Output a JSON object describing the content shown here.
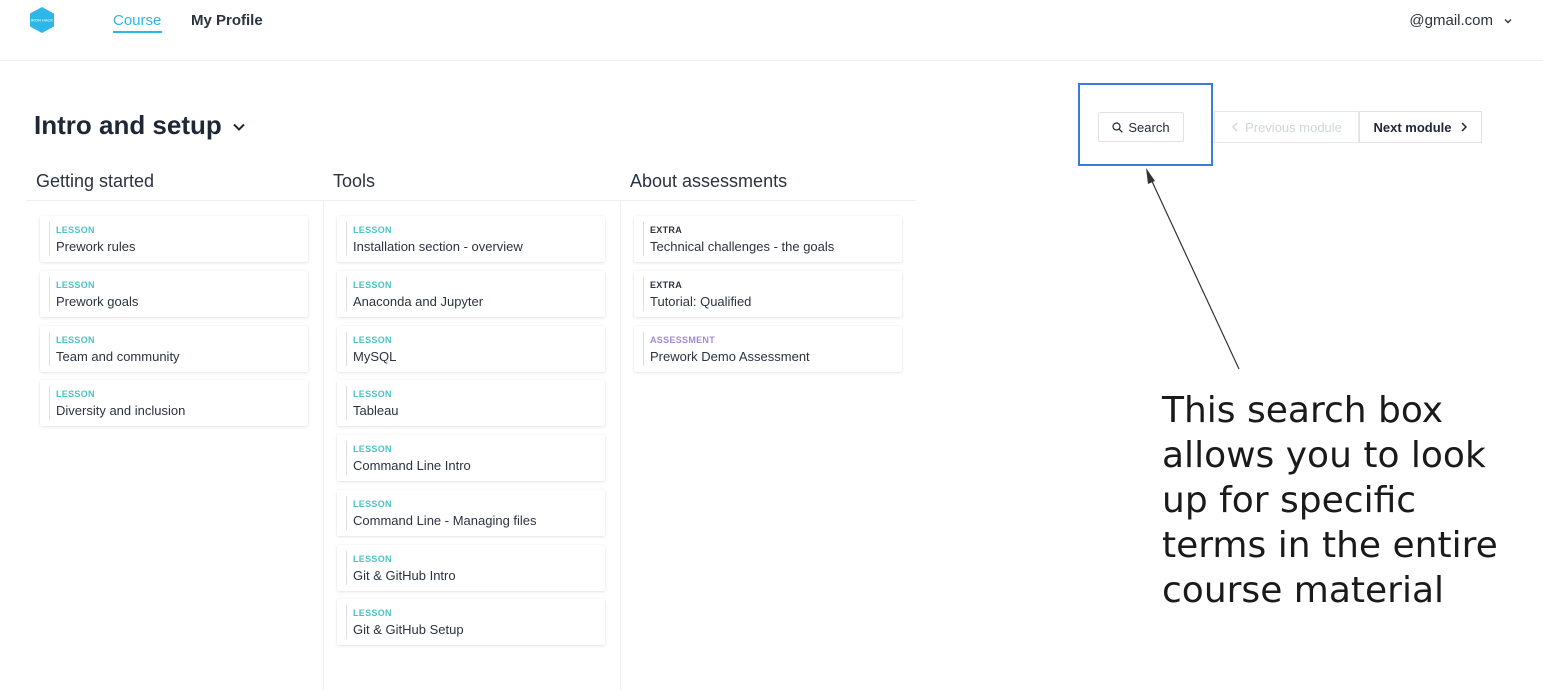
{
  "nav": {
    "course": "Course",
    "profile": "My Profile",
    "account": "@gmail.com",
    "logo_text": "IRON HACK"
  },
  "module": {
    "title": "Intro and setup"
  },
  "toolbar": {
    "search": "Search",
    "previous": "Previous module",
    "next": "Next module"
  },
  "columns": [
    {
      "heading": "Getting started",
      "items": [
        {
          "tag": "LESSON",
          "title": "Prework rules"
        },
        {
          "tag": "LESSON",
          "title": "Prework goals"
        },
        {
          "tag": "LESSON",
          "title": "Team and community"
        },
        {
          "tag": "LESSON",
          "title": "Diversity and inclusion"
        }
      ]
    },
    {
      "heading": "Tools",
      "items": [
        {
          "tag": "LESSON",
          "title": "Installation section - overview"
        },
        {
          "tag": "LESSON",
          "title": "Anaconda and Jupyter"
        },
        {
          "tag": "LESSON",
          "title": "MySQL"
        },
        {
          "tag": "LESSON",
          "title": "Tableau"
        },
        {
          "tag": "LESSON",
          "title": "Command Line Intro"
        },
        {
          "tag": "LESSON",
          "title": "Command Line - Managing files"
        },
        {
          "tag": "LESSON",
          "title": "Git & GitHub Intro"
        },
        {
          "tag": "LESSON",
          "title": "Git & GitHub Setup"
        }
      ]
    },
    {
      "heading": "About assessments",
      "items": [
        {
          "tag": "EXTRA",
          "title": "Technical challenges - the goals"
        },
        {
          "tag": "EXTRA",
          "title": "Tutorial: Qualified"
        },
        {
          "tag": "ASSESSMENT",
          "title": "Prework Demo Assessment"
        }
      ]
    }
  ],
  "annotation": {
    "lines": [
      "This search box",
      "allows you to look",
      "up for specific",
      "terms in the entire",
      "course material"
    ]
  },
  "colors": {
    "accent": "#2fb6e9",
    "lesson_tag": "#4ec3c3",
    "assessment_tag": "#a48ad4",
    "highlight": "#3d7ae0"
  }
}
